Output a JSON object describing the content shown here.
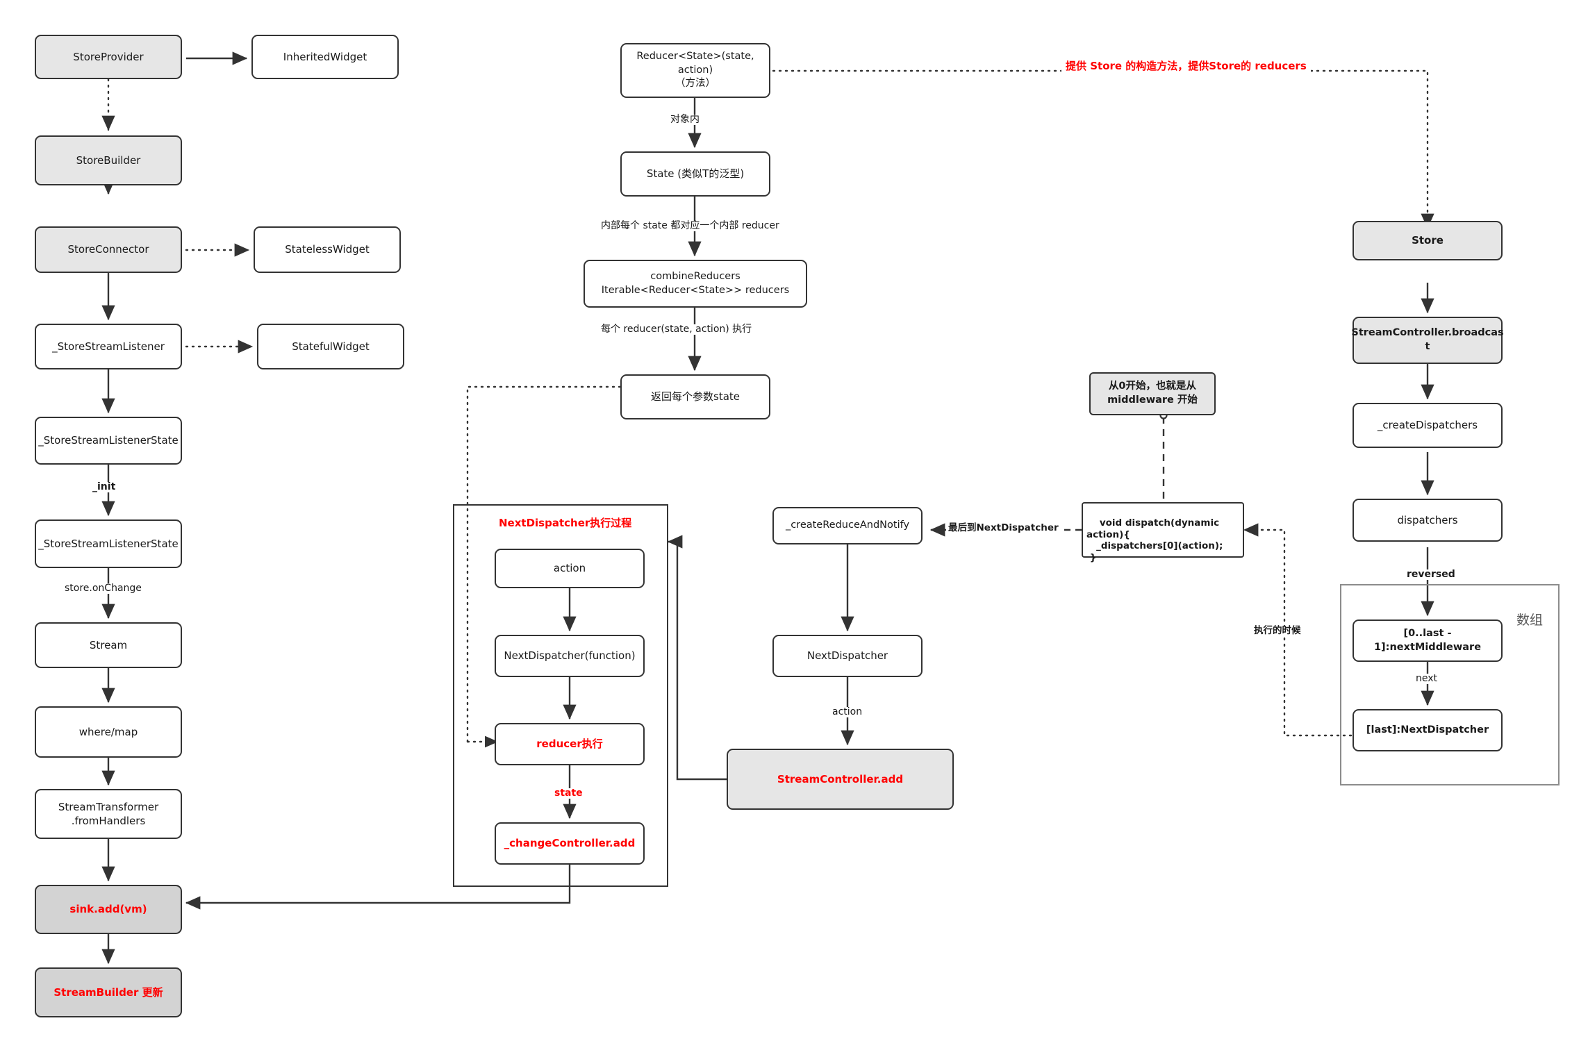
{
  "diagram": {
    "title_annotation": "提供 Store 的构造方法，提供Store的 reducers",
    "left_column": {
      "nodes": [
        {
          "id": "store-provider",
          "label": "StoreProvider"
        },
        {
          "id": "inherited-widget",
          "label": "InheritedWidget"
        },
        {
          "id": "store-builder",
          "label": "StoreBuilder"
        },
        {
          "id": "store-connector",
          "label": "StoreConnector"
        },
        {
          "id": "stateless-widget",
          "label": "StatelessWidget"
        },
        {
          "id": "store-stream-listener",
          "label": "_StoreStreamListener"
        },
        {
          "id": "stateful-widget",
          "label": "StatefulWidget"
        },
        {
          "id": "store-stream-listener-state-1",
          "label": "_StoreStreamListenerState"
        },
        {
          "id": "store-stream-listener-state-2",
          "label": "_StoreStreamListenerState"
        },
        {
          "id": "stream",
          "label": "Stream"
        },
        {
          "id": "where-map",
          "label": "where/map"
        },
        {
          "id": "stream-transformer",
          "label": "StreamTransformer\n.fromHandlers"
        },
        {
          "id": "sink-add",
          "label": "sink.add(vm)"
        },
        {
          "id": "stream-builder-update",
          "label": "StreamBuilder 更新"
        }
      ],
      "edge_labels": {
        "init": "_init",
        "on_change": "store.onChange"
      }
    },
    "middle_column": {
      "nodes": [
        {
          "id": "reducer-state",
          "label": "Reducer<State>(state,\naction)\n（方法）"
        },
        {
          "id": "state-generic",
          "label": "State (类似T的泛型)"
        },
        {
          "id": "combine-reducers",
          "label": "combineReducers\nIterable<Reducer<State>> reducers"
        },
        {
          "id": "return-state",
          "label": "返回每个参数state"
        }
      ],
      "edge_labels": {
        "in_object": "对象内",
        "each_state": "内部每个 state 都对应一个内部 reducer",
        "each_reducer": "每个 reducer(state, action) 执行"
      }
    },
    "next_dispatcher_group": {
      "title": "NextDispatcher执行过程",
      "nodes": [
        {
          "id": "action",
          "label": "action"
        },
        {
          "id": "next-dispatcher-function",
          "label": "NextDispatcher(function)"
        },
        {
          "id": "reducer-exec",
          "label": "reducer执行"
        },
        {
          "id": "change-controller-add",
          "label": "_changeController.add"
        }
      ],
      "edge_labels": {
        "state": "state"
      }
    },
    "notify_column": {
      "nodes": [
        {
          "id": "create-reduce-and-notify",
          "label": "_createReduceAndNotify"
        },
        {
          "id": "next-dispatcher",
          "label": "NextDispatcher"
        },
        {
          "id": "stream-controller-add",
          "label": "StreamController.add"
        }
      ],
      "edge_labels": {
        "action": "action",
        "last_to_next_dispatcher": "最后到NextDispatcher"
      }
    },
    "dispatch_area": {
      "callout": "从0开始，也就是从\nmiddleware 开始",
      "code_block": "void dispatch(dynamic\naction){\n   _dispatchers[0](action);\n }",
      "edge_labels": {
        "when_executing": "执行的时候"
      }
    },
    "right_column": {
      "nodes": [
        {
          "id": "store",
          "label": "Store"
        },
        {
          "id": "stream-controller-broadcast",
          "label": "StreamController.broadcas\nt"
        },
        {
          "id": "create-dispatchers",
          "label": "_createDispatchers"
        },
        {
          "id": "dispatchers",
          "label": "dispatchers"
        },
        {
          "id": "next-middleware",
          "label": "[0..last - 1]:nextMiddleware"
        },
        {
          "id": "last-next-dispatcher",
          "label": "[last]:NextDispatcher"
        }
      ],
      "group_label": "数组",
      "edge_labels": {
        "reversed": "reversed",
        "next": "next"
      }
    },
    "colors": {
      "accent_red": "#ff0000",
      "node_fill_grey": "#e6e6e6",
      "node_fill_dark_grey": "#d3d3d3",
      "stroke": "#333333",
      "group_stroke_grey": "#8c8c8c"
    }
  }
}
